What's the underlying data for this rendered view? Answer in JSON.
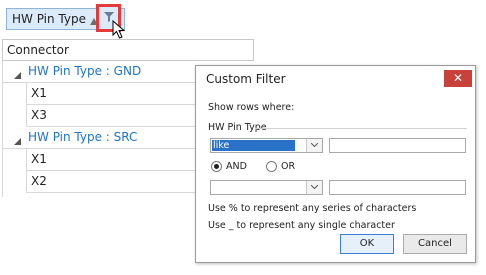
{
  "group_chip": {
    "label": "HW Pin Type"
  },
  "grid": {
    "column_header": "Connector",
    "groups": [
      {
        "label": "HW Pin Type : GND",
        "rows": [
          "X1",
          "X3"
        ]
      },
      {
        "label": "HW Pin Type : SRC",
        "rows": [
          "X1",
          "X2"
        ]
      }
    ]
  },
  "dialog": {
    "title": "Custom Filter",
    "close_label": "✕",
    "show_rows_label": "Show rows where:",
    "field_label": "HW Pin Type",
    "operator1": "like",
    "value1": "",
    "and_label": "AND",
    "or_label": "OR",
    "logic_selected": "AND",
    "operator2": "",
    "value2": "",
    "hint1": "Use % to represent any series of characters",
    "hint2": "Use _ to represent any single character",
    "ok_label": "OK",
    "cancel_label": "Cancel"
  },
  "colors": {
    "accent_blue": "#1e74c8",
    "highlight_red": "#e43a3a",
    "close_red": "#c8413a",
    "selection_blue": "#2a72c8"
  }
}
